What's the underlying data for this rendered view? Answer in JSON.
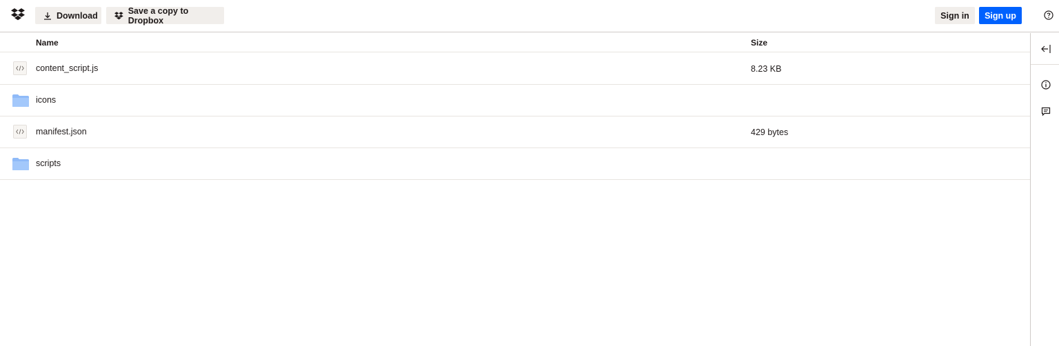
{
  "topbar": {
    "logo_icon": "dropbox-logo-icon",
    "download_label": "Download",
    "download_icon": "download-icon",
    "save_label": "Save a copy to Dropbox",
    "save_icon": "dropbox-icon",
    "signin_label": "Sign in",
    "signup_label": "Sign up",
    "help_icon": "help-circle-icon",
    "accent_color": "#0061fe"
  },
  "table": {
    "columns": {
      "name": "Name",
      "size": "Size"
    },
    "rows": [
      {
        "name": "content_script.js",
        "size": "8.23 KB",
        "type": "code-file",
        "icon": "code-file-icon"
      },
      {
        "name": "icons",
        "size": "",
        "type": "folder",
        "icon": "folder-icon"
      },
      {
        "name": "manifest.json",
        "size": "429 bytes",
        "type": "code-file",
        "icon": "code-file-icon"
      },
      {
        "name": "scripts",
        "size": "",
        "type": "folder",
        "icon": "folder-icon"
      }
    ]
  },
  "sidepanel": {
    "icons": [
      "collapse-panel-icon",
      "info-icon",
      "comment-icon"
    ]
  }
}
